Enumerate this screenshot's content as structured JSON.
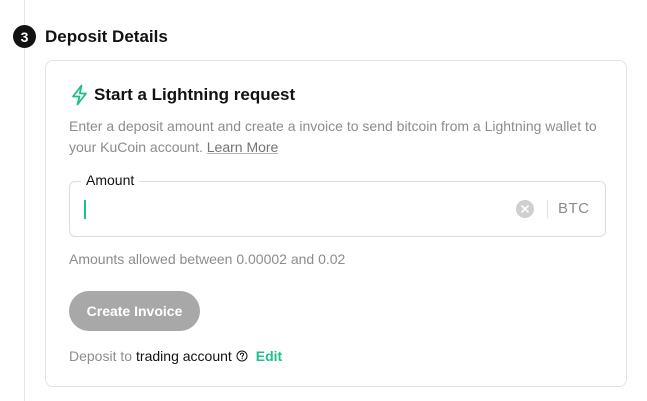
{
  "step": {
    "number": "3",
    "title": "Deposit Details"
  },
  "card": {
    "icon": "lightning-bolt-icon",
    "title": "Start a Lightning request",
    "description": "Enter a deposit amount and create a invoice to send bitcoin from a Lightning wallet to your KuCoin account.",
    "learn_more": "Learn More"
  },
  "amount": {
    "label": "Amount",
    "value": "",
    "placeholder": "",
    "clear_icon": "clear-icon",
    "unit": "BTC"
  },
  "hint": "Amounts allowed between 0.00002 and 0.02",
  "create_button": "Create Invoice",
  "deposit": {
    "prefix": "Deposit to",
    "account": "trading account",
    "help_icon": "question-circle-icon",
    "edit": "Edit"
  },
  "colors": {
    "accent": "#1ebf8e",
    "button_disabled": "#a8a8a8",
    "text_primary": "#121212",
    "text_secondary": "#8c8c8c",
    "border": "#dcdcdc"
  }
}
